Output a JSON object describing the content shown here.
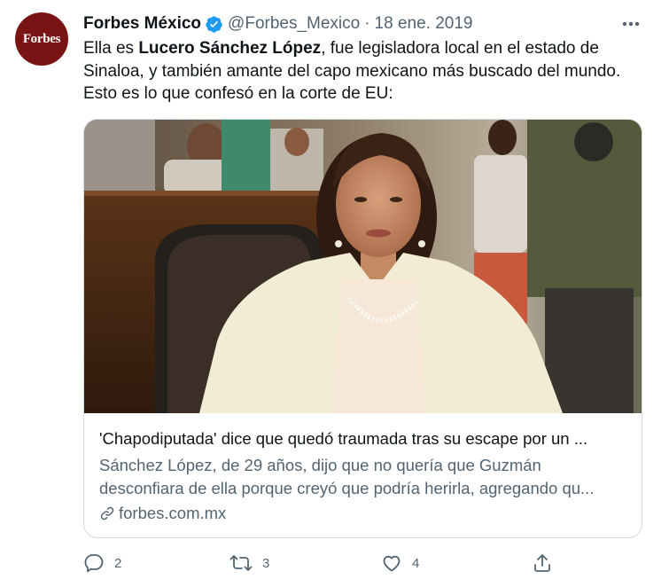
{
  "tweet": {
    "avatar_text": "Forbes",
    "author_name": "Forbes México",
    "handle": "@Forbes_Mexico",
    "separator": "·",
    "date": "18 ene. 2019",
    "text": {
      "part1": "Ella es ",
      "bold": "Lucero Sánchez López",
      "part2": ", fue legisladora local en el estado de Sinaloa, y también amante del capo mexicano más buscado del mundo. Esto es lo que confesó en la corte de EU:"
    },
    "card": {
      "title": "'Chapodiputada' dice que quedó traumada tras su escape por un ...",
      "description_line1": "Sánchez López, de 29 años, dijo que no quería que Guzmán",
      "description_line2": "desconfiara de ella porque creyó que podría herirla, agregando qu...",
      "domain": "forbes.com.mx"
    },
    "actions": {
      "reply_count": "2",
      "retweet_count": "3",
      "like_count": "4"
    }
  },
  "icons": {
    "verified": "verified-badge-icon",
    "more": "more-dots-icon",
    "link": "link-icon",
    "reply": "reply-icon",
    "retweet": "retweet-icon",
    "like": "heart-icon",
    "share": "share-icon"
  },
  "colors": {
    "accent": "#1d9bf0",
    "text": "#0f1419",
    "muted": "#536471",
    "border": "#cfd9de",
    "avatar_bg": "#7a1414"
  }
}
